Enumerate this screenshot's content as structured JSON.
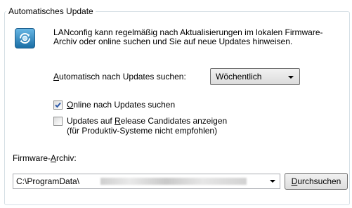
{
  "group": {
    "title": "Automatisches Update"
  },
  "description": "LANconfig kann regelmäßig nach Aktualisierungen im lokalen Firmware-Archiv oder online suchen und Sie auf neue Updates hinweisen.",
  "auto_update": {
    "label_mnemonic": "A",
    "label_rest": "utomatisch nach Updates suchen:",
    "selected": "Wöchentlich"
  },
  "checkboxes": [
    {
      "label_mnemonic": "O",
      "label_rest": "nline nach Updates suchen",
      "checked": true
    },
    {
      "label_pre": "Updates auf ",
      "label_mnemonic": "R",
      "label_rest": "elease Candidates anzeigen",
      "note": "(für Produktiv-Systeme nicht empfohlen)",
      "checked": false
    }
  ],
  "archive": {
    "label_pre": "Firmware-",
    "label_mnemonic": "A",
    "label_rest": "rchiv:",
    "path_visible": "C:\\ProgramData\\"
  },
  "browse_button": {
    "label_mnemonic": "D",
    "label_rest": "urchsuchen"
  },
  "icons": {
    "update": "update-globe-icon",
    "dropdown": "chevron-down-icon",
    "check": "checkmark-icon"
  },
  "colors": {
    "group_border": "#d5dfe5",
    "icon_blue": "#1a6ea5",
    "check_blue": "#2c59a8"
  }
}
